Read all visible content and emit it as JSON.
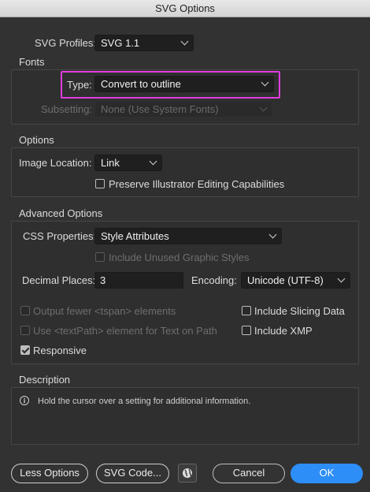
{
  "window": {
    "title": "SVG Options"
  },
  "svg_profiles": {
    "label": "SVG Profiles:",
    "value": "SVG 1.1"
  },
  "fonts": {
    "title": "Fonts",
    "type_label": "Type:",
    "type_value": "Convert to outline",
    "subsetting_label": "Subsetting:",
    "subsetting_value": "None (Use System Fonts)"
  },
  "options": {
    "title": "Options",
    "image_location_label": "Image Location:",
    "image_location_value": "Link",
    "preserve_label": "Preserve Illustrator Editing Capabilities"
  },
  "advanced": {
    "title": "Advanced Options",
    "css_label": "CSS Properties:",
    "css_value": "Style Attributes",
    "include_unused_label": "Include Unused Graphic Styles",
    "decimal_label": "Decimal Places:",
    "decimal_value": "3",
    "encoding_label": "Encoding:",
    "encoding_value": "Unicode (UTF-8)",
    "tspan_label": "Output fewer <tspan> elements",
    "textpath_label": "Use <textPath> element for Text on Path",
    "responsive_label": "Responsive",
    "slicing_label": "Include Slicing Data",
    "xmp_label": "Include XMP"
  },
  "description": {
    "title": "Description",
    "text": "Hold the cursor over a setting for additional information.",
    "info_glyph": "i"
  },
  "buttons": {
    "less_options": "Less Options",
    "svg_code": "SVG Code...",
    "cancel": "Cancel",
    "ok": "OK"
  },
  "colors": {
    "accent": "#2d8ef7",
    "highlight": "#e23ce0",
    "background": "#323232"
  },
  "icons": {
    "web_preview": "globe-icon",
    "info": "info-icon"
  }
}
